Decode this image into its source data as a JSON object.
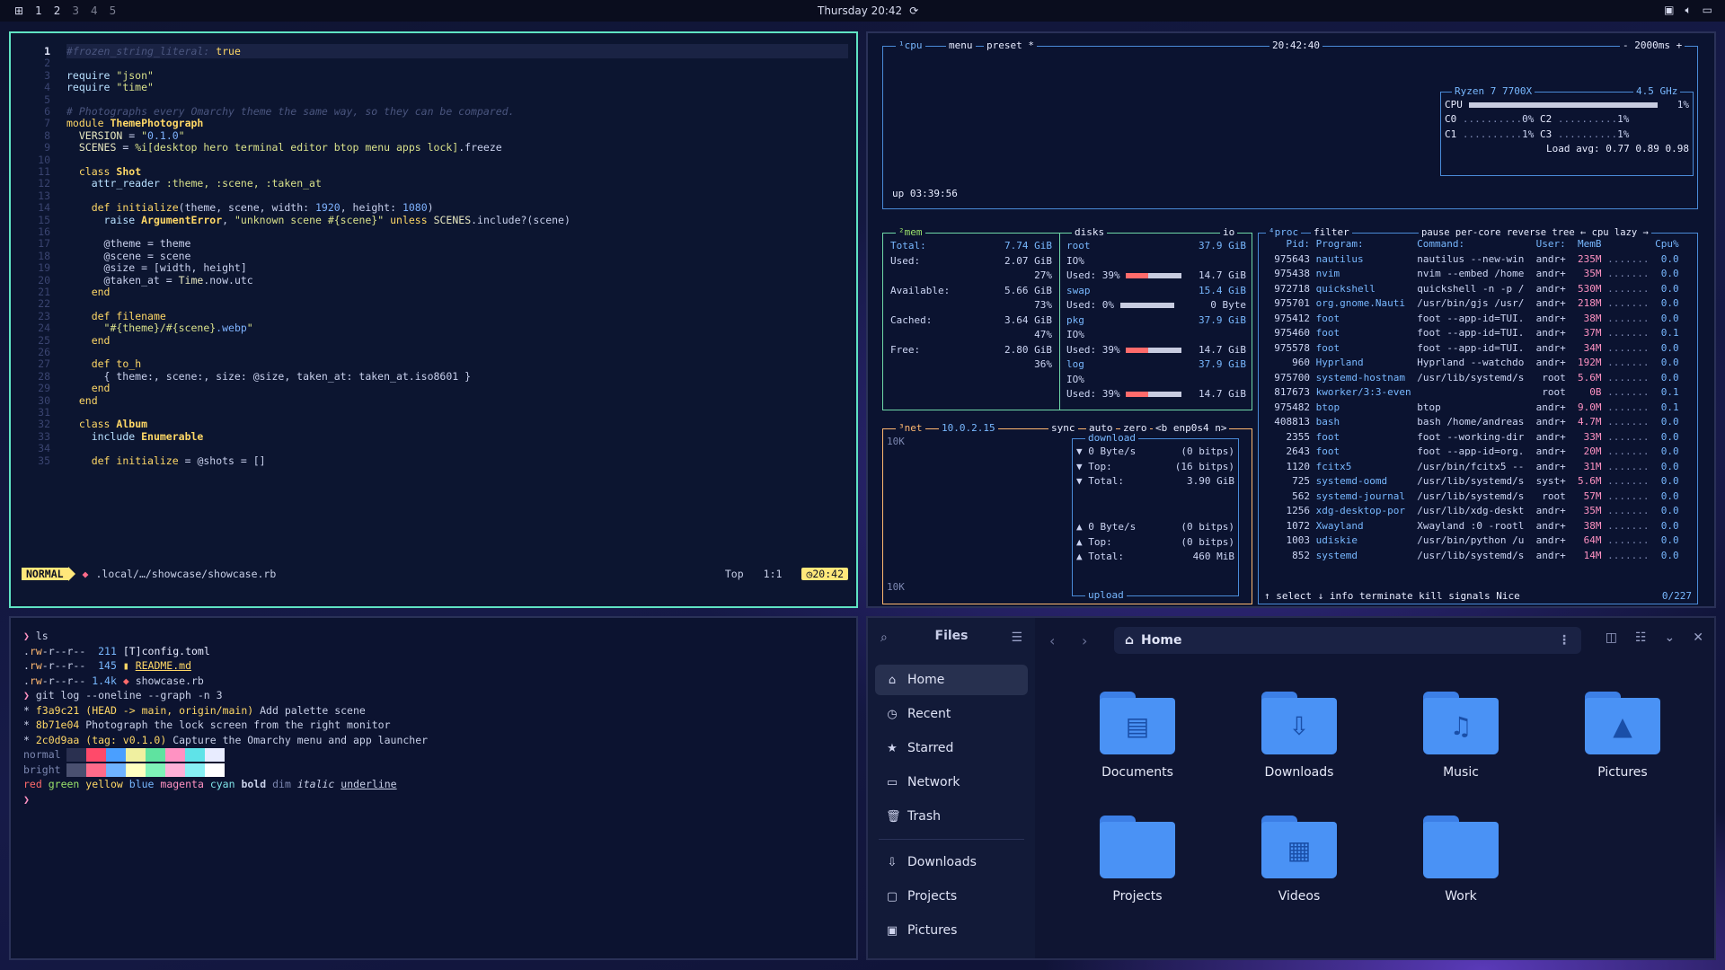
{
  "topbar": {
    "workspaces": [
      "1",
      "2",
      "3",
      "4",
      "5"
    ],
    "clock": "Thursday 20:42",
    "tray": [
      "display-icon",
      "volume-icon",
      "chat-icon"
    ]
  },
  "editor": {
    "lines": [
      {
        "n": "1",
        "html": "<span class='c-cm'>#frozen_string_literal:</span> <span class='c-kw'>true</span>"
      },
      {
        "n": "2",
        "html": ""
      },
      {
        "n": "3",
        "html": "<span class='c-var'>require</span> <span class='c-str'>\"json\"</span>"
      },
      {
        "n": "4",
        "html": "<span class='c-var'>require</span> <span class='c-str'>\"time\"</span>"
      },
      {
        "n": "5",
        "html": ""
      },
      {
        "n": "6",
        "html": "<span class='c-cm'># Photographs every Omarchy theme the same way, so they can be compared.</span>"
      },
      {
        "n": "7",
        "html": "<span class='c-kw'>module</span> <span class='c-cls'>ThemePhotograph</span>"
      },
      {
        "n": "8",
        "html": "  <span class='c-sym'>VERSION</span> = <span class='c-str'>\"</span><span class='c-num'>0.1.0</span><span class='c-str'>\"</span>"
      },
      {
        "n": "9",
        "html": "  <span class='c-sym'>SCENES</span> = <span class='c-str'>%i[desktop hero terminal editor btop menu apps lock]</span>.freeze"
      },
      {
        "n": "10",
        "html": ""
      },
      {
        "n": "11",
        "html": "  <span class='c-kw'>class</span> <span class='c-cls'>Shot</span>"
      },
      {
        "n": "12",
        "html": "    <span class='c-var'>attr_reader</span> <span class='c-str'>:theme, :scene, :taken_at</span>"
      },
      {
        "n": "13",
        "html": ""
      },
      {
        "n": "14",
        "html": "    <span class='c-kw'>def</span> <span class='c-kw'>initialize</span>(theme, scene, width: <span class='c-num'>1920</span>, height: <span class='c-num'>1080</span>)"
      },
      {
        "n": "15",
        "html": "      <span class='c-var'>raise</span> <span class='c-cls'>ArgumentError</span>, <span class='c-str'>\"unknown scene #{scene}\"</span> <span class='c-kw'>unless</span> <span class='c-sym'>SCENES</span>.include?(scene)"
      },
      {
        "n": "16",
        "html": ""
      },
      {
        "n": "17",
        "html": "      @theme = theme"
      },
      {
        "n": "18",
        "html": "      @scene = scene"
      },
      {
        "n": "19",
        "html": "      @size = [width, height]"
      },
      {
        "n": "20",
        "html": "      @taken_at = <span class='c-sym'>Time</span>.now.utc"
      },
      {
        "n": "21",
        "html": "    <span class='c-kw'>end</span>"
      },
      {
        "n": "22",
        "html": ""
      },
      {
        "n": "23",
        "html": "    <span class='c-kw'>def</span> <span class='c-kw'>filename</span>"
      },
      {
        "n": "24",
        "html": "      <span class='c-str'>\"#{theme}/#{scene}</span><span class='c-num'>.webp</span><span class='c-str'>\"</span>"
      },
      {
        "n": "25",
        "html": "    <span class='c-kw'>end</span>"
      },
      {
        "n": "26",
        "html": ""
      },
      {
        "n": "27",
        "html": "    <span class='c-kw'>def</span> <span class='c-kw'>to_h</span>"
      },
      {
        "n": "28",
        "html": "      { theme:, scene:, size: @size, taken_at: taken_at.iso8601 }"
      },
      {
        "n": "29",
        "html": "    <span class='c-kw'>end</span>"
      },
      {
        "n": "30",
        "html": "  <span class='c-kw'>end</span>"
      },
      {
        "n": "31",
        "html": ""
      },
      {
        "n": "32",
        "html": "  <span class='c-kw'>class</span> <span class='c-cls'>Album</span>"
      },
      {
        "n": "33",
        "html": "    <span class='c-var'>include</span> <span class='c-cls'>Enumerable</span>"
      },
      {
        "n": "34",
        "html": ""
      },
      {
        "n": "35",
        "html": "    <span class='c-kw'>def</span> <span class='c-kw'>initialize</span> = @shots = []"
      }
    ],
    "status": {
      "mode": "NORMAL",
      "file": ".local/…/showcase/showcase.rb",
      "pos": "Top",
      "lc": "1:1",
      "time": "20:42"
    }
  },
  "btop": {
    "cpu": {
      "title": "¹cpu",
      "menu": "menu",
      "preset": "preset *",
      "clock": "20:42:40",
      "interval": "- 2000ms +",
      "model": "Ryzen 7 7700X",
      "freq": "4.5 GHz",
      "cpu_total": "1%",
      "cores": [
        [
          "C0",
          "0%"
        ],
        [
          "C1",
          "1%"
        ],
        [
          "C2",
          "1%"
        ],
        [
          "C3",
          "1%"
        ]
      ],
      "load": "Load avg: 0.77 0.89 0.98",
      "uptime": "up 03:39:56"
    },
    "mem": {
      "title": "²mem",
      "total": "7.74 GiB",
      "used": "2.07 GiB",
      "used_pct": "27%",
      "available": "5.66 GiB",
      "avail_pct": "73%",
      "cached": "3.64 GiB",
      "cached_pct": "47%",
      "free": "2.80 GiB",
      "free_pct": "36%"
    },
    "disks": {
      "title": "disks",
      "io": "io",
      "items": [
        {
          "name": "root",
          "size": "37.9 GiB",
          "used_pct": "39%",
          "used": "14.7 GiB"
        },
        {
          "name": "swap",
          "size": "15.4 GiB",
          "used_pct": "0%",
          "used": "0 Byte"
        },
        {
          "name": "pkg",
          "size": "37.9 GiB",
          "used_pct": "39%",
          "used": "14.7 GiB"
        },
        {
          "name": "log",
          "size": "37.9 GiB",
          "used_pct": "39%",
          "used": "14.7 GiB"
        }
      ]
    },
    "net": {
      "title": "³net",
      "ip": "10.0.2.15",
      "sync": "sync",
      "auto": "auto",
      "zero": "zero",
      "iface": "<b enp0s4 n>",
      "scale": "10K",
      "download": "download",
      "upload": "upload",
      "dl": [
        [
          "▼ 0 Byte/s",
          "(0 bitps)"
        ],
        [
          "▼ Top:",
          "(16 bitps)"
        ],
        [
          "▼ Total:",
          "3.90 GiB"
        ]
      ],
      "ul": [
        [
          "▲ 0 Byte/s",
          "(0 bitps)"
        ],
        [
          "▲ Top:",
          "(0 bitps)"
        ],
        [
          "▲ Total:",
          "460 MiB"
        ]
      ]
    },
    "proc": {
      "title": "⁴proc",
      "filter": "filter",
      "opts": "pause per-core reverse tree ← cpu lazy →",
      "headers": [
        "Pid:",
        "Program:",
        "Command:",
        "User:",
        "MemB",
        "Cpu%"
      ],
      "rows": [
        [
          "975643",
          "nautilus",
          "nautilus --new-win",
          "andr+",
          "235M",
          "0.0"
        ],
        [
          "975438",
          "nvim",
          "nvim --embed /home",
          "andr+",
          "35M",
          "0.0"
        ],
        [
          "972718",
          "quickshell",
          "quickshell -n -p /",
          "andr+",
          "530M",
          "0.0"
        ],
        [
          "975701",
          "org.gnome.Nauti",
          "/usr/bin/gjs /usr/",
          "andr+",
          "218M",
          "0.0"
        ],
        [
          "975412",
          "foot",
          "foot --app-id=TUI.",
          "andr+",
          "38M",
          "0.0"
        ],
        [
          "975460",
          "foot",
          "foot --app-id=TUI.",
          "andr+",
          "37M",
          "0.1"
        ],
        [
          "975578",
          "foot",
          "foot --app-id=TUI.",
          "andr+",
          "34M",
          "0.0"
        ],
        [
          "960",
          "Hyprland",
          "Hyprland --watchdo",
          "andr+",
          "192M",
          "0.0"
        ],
        [
          "975700",
          "systemd-hostnam",
          "/usr/lib/systemd/s",
          "root",
          "5.6M",
          "0.0"
        ],
        [
          "817673",
          "kworker/3:3-even",
          "",
          "root",
          "0B",
          "0.1"
        ],
        [
          "975482",
          "btop",
          "btop",
          "andr+",
          "9.0M",
          "0.1"
        ],
        [
          "408813",
          "bash",
          "bash /home/andreas",
          "andr+",
          "4.7M",
          "0.0"
        ],
        [
          "2355",
          "foot",
          "foot --working-dir",
          "andr+",
          "33M",
          "0.0"
        ],
        [
          "2643",
          "foot",
          "foot --app-id=org.",
          "andr+",
          "20M",
          "0.0"
        ],
        [
          "1120",
          "fcitx5",
          "/usr/bin/fcitx5 --",
          "andr+",
          "31M",
          "0.0"
        ],
        [
          "725",
          "systemd-oomd",
          "/usr/lib/systemd/s",
          "syst+",
          "5.6M",
          "0.0"
        ],
        [
          "562",
          "systemd-journal",
          "/usr/lib/systemd/s",
          "root",
          "57M",
          "0.0"
        ],
        [
          "1256",
          "xdg-desktop-por",
          "/usr/lib/xdg-deskt",
          "andr+",
          "35M",
          "0.0"
        ],
        [
          "1072",
          "Xwayland",
          "Xwayland :0 -rootl",
          "andr+",
          "38M",
          "0.0"
        ],
        [
          "1003",
          "udiskie",
          "/usr/bin/python /u",
          "andr+",
          "64M",
          "0.0"
        ],
        [
          "852",
          "systemd",
          "/usr/lib/systemd/s",
          "andr+",
          "14M",
          "0.0"
        ]
      ],
      "footer": "↑ select ↓  info  terminate  kill  signals  Nice",
      "count": "0/227"
    }
  },
  "terminal": {
    "lines": [
      "<span class='cm'>❯</span> ls",
      ".<span class='co'>rw</span>-r--r--  <span class='cy'>211</span> <span class='cw'>[T]config.toml</span>",
      ".<span class='co'>rw</span>-r--r--  <span class='cy'>145</span> <span class='c-kw'>▮ <u>README.md</u></span>",
      ".<span class='co'>rw</span>-r--r-- <span class='cy'>1.4k</span> <span class='cr'>◆</span> showcase.rb",
      "<span class='cm'>❯</span> git log --oneline --graph -n 3",
      "* <span class='c-kw'>f3a9c21</span> <span class='c-kw'>(HEAD -> main, origin/main)</span> Add palette scene",
      "* <span class='c-kw'>8b71e04</span> Photograph the lock screen from the right monitor",
      "* <span class='c-kw'>2c0d9aa</span> <span class='c-kw'>(tag: v0.1.0)</span> Capture the Omarchy menu and app launcher"
    ],
    "normal": "normal",
    "bright": "bright",
    "sample": "<span class='cr'>red</span> <span class='cg'>green</span> <span class='c-kw'>yellow</span> <span class='cy'>blue</span> <span class='cm'>magenta</span> <span style='color:#7fe3e8'>cyan</span> <b>bold</b> <span class='cd'>dim</span> <i>italic</i> <u>underline</u>",
    "prompt": "❯"
  },
  "files": {
    "title": "Files",
    "path": "Home",
    "sidebar": [
      {
        "label": "Home",
        "icon": "home-icon"
      },
      {
        "label": "Recent",
        "icon": "clock-icon"
      },
      {
        "label": "Starred",
        "icon": "star-icon"
      },
      {
        "label": "Network",
        "icon": "network-icon"
      },
      {
        "label": "Trash",
        "icon": "trash-icon"
      },
      {
        "label": "Downloads",
        "icon": "download-icon"
      },
      {
        "label": "Projects",
        "icon": "folder-icon"
      },
      {
        "label": "Pictures",
        "icon": "picture-icon"
      }
    ],
    "folders": [
      {
        "label": "Documents",
        "glyph": "▤"
      },
      {
        "label": "Downloads",
        "glyph": "⇩"
      },
      {
        "label": "Music",
        "glyph": "♫"
      },
      {
        "label": "Pictures",
        "glyph": "▲"
      },
      {
        "label": "Projects",
        "glyph": ""
      },
      {
        "label": "Videos",
        "glyph": "▦"
      },
      {
        "label": "Work",
        "glyph": ""
      }
    ]
  }
}
